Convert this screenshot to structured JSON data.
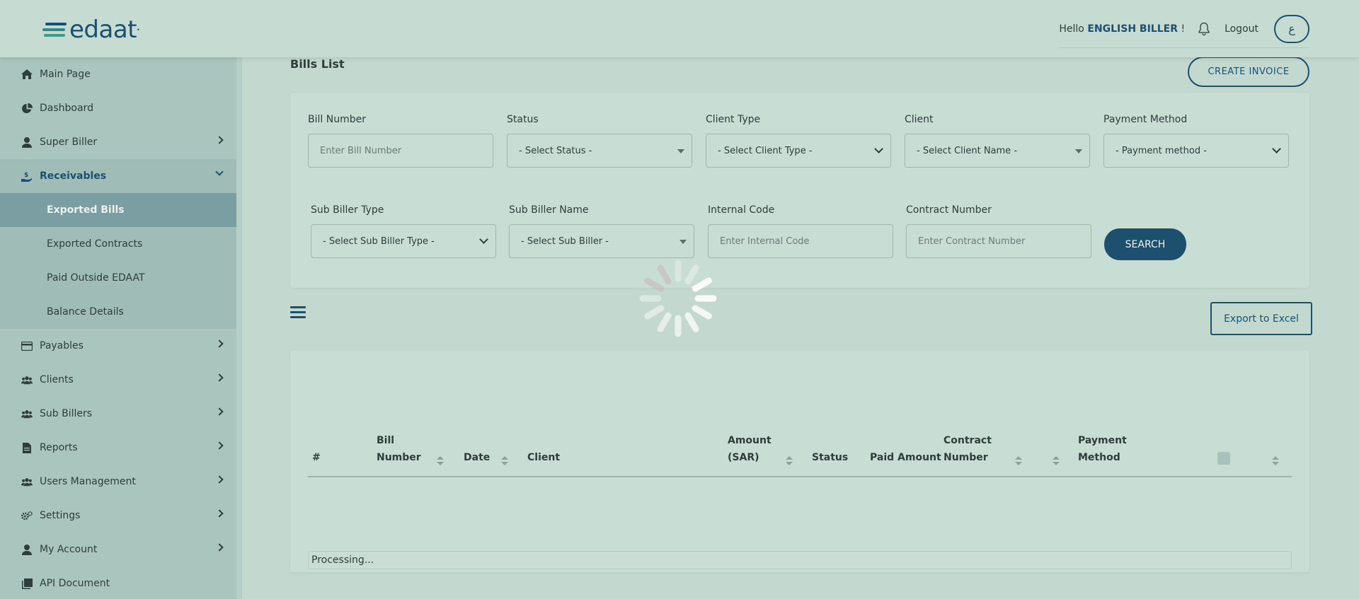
{
  "header": {
    "logo_text": "edaat",
    "greeting": "Hello",
    "user_name": "ENGLISH BILLER",
    "greeting_suffix": "!",
    "logout_label": "Logout",
    "language_toggle": "ع"
  },
  "sidebar": {
    "items": [
      {
        "label": "Main Page",
        "icon": "home-icon"
      },
      {
        "label": "Dashboard",
        "icon": "pie-chart-icon"
      },
      {
        "label": "Super Biller",
        "icon": "user-icon"
      },
      {
        "label": "Receivables",
        "icon": "hand-money-icon"
      },
      {
        "label": "Payables",
        "icon": "credit-card-icon"
      },
      {
        "label": "Clients",
        "icon": "users-icon"
      },
      {
        "label": "Sub Billers",
        "icon": "users-icon"
      },
      {
        "label": "Reports",
        "icon": "file-icon"
      },
      {
        "label": "Users Management",
        "icon": "users-icon"
      },
      {
        "label": "Settings",
        "icon": "gears-icon"
      },
      {
        "label": "My Account",
        "icon": "user-icon"
      },
      {
        "label": "API Document",
        "icon": "documents-icon"
      }
    ],
    "receivables_sub": [
      {
        "label": "Exported Bills"
      },
      {
        "label": "Exported Contracts"
      },
      {
        "label": "Paid Outside EDAAT"
      },
      {
        "label": "Balance Details"
      }
    ]
  },
  "main": {
    "title": "Bills List",
    "create_button": "CREATE INVOICE",
    "filters": {
      "bill_number": {
        "label": "Bill Number",
        "placeholder": "Enter Bill Number"
      },
      "status": {
        "label": "Status",
        "value": "- Select Status -"
      },
      "client_type": {
        "label": "Client Type",
        "value": "- Select Client Type -"
      },
      "client": {
        "label": "Client",
        "value": "- Select Client Name -"
      },
      "payment_method": {
        "label": "Payment Method",
        "value": "- Payment method -"
      },
      "sub_biller_type": {
        "label": "Sub Biller Type",
        "value": "- Select Sub Biller Type -"
      },
      "sub_biller_name": {
        "label": "Sub Biller Name",
        "value": "- Select Sub Biller -"
      },
      "internal_code": {
        "label": "Internal Code",
        "placeholder": "Enter Internal Code"
      },
      "contract_number": {
        "label": "Contract Number",
        "placeholder": "Enter Contract Number"
      }
    },
    "search_button": "SEARCH",
    "export_button": "Export to Excel",
    "table": {
      "columns": [
        {
          "line1": "#",
          "line2": ""
        },
        {
          "line1": "Bill",
          "line2": "Number"
        },
        {
          "line1": "Date",
          "line2": ""
        },
        {
          "line1": "Client",
          "line2": ""
        },
        {
          "line1": "Amount",
          "line2": "(SAR)"
        },
        {
          "line1": "Status",
          "line2": ""
        },
        {
          "line1": "Paid Amount",
          "line2": ""
        },
        {
          "line1": "Contract",
          "line2": "Number"
        },
        {
          "line1": "Payment",
          "line2": "Method"
        }
      ],
      "processing_text": "Processing..."
    }
  },
  "colors": {
    "primary": "#1d4f6e",
    "background": "#c3d9cf",
    "sidebar": "#a9c5bd",
    "active_sub_item": "#7b9ea3"
  }
}
